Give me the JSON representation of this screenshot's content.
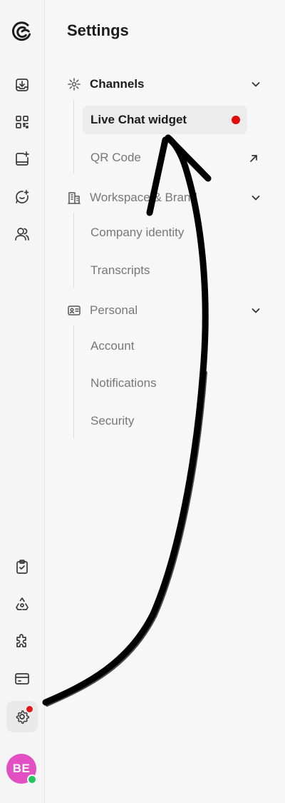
{
  "settings": {
    "title": "Settings",
    "sections": [
      {
        "label": "Channels",
        "items": [
          {
            "label": "Live Chat widget"
          },
          {
            "label": "QR Code"
          }
        ]
      },
      {
        "label": "Workspace & Brand",
        "items": [
          {
            "label": "Company identity"
          },
          {
            "label": "Transcripts"
          }
        ]
      },
      {
        "label": "Personal",
        "items": [
          {
            "label": "Account"
          },
          {
            "label": "Notifications"
          },
          {
            "label": "Security"
          }
        ]
      }
    ]
  },
  "user": {
    "initials": "BE",
    "avatar_color": "#e24fc3",
    "status_color": "#22c55e"
  },
  "colors": {
    "notification_dot": "#e2161b",
    "arrow": "#000000"
  },
  "rail_icons": [
    "logo-icon",
    "inbox-icon",
    "widgets-icon",
    "new-note-icon",
    "chat-sparkle-icon",
    "users-icon",
    "clipboard-check-icon",
    "recycle-icon",
    "puzzle-icon",
    "credit-card-icon",
    "gear-icon"
  ]
}
